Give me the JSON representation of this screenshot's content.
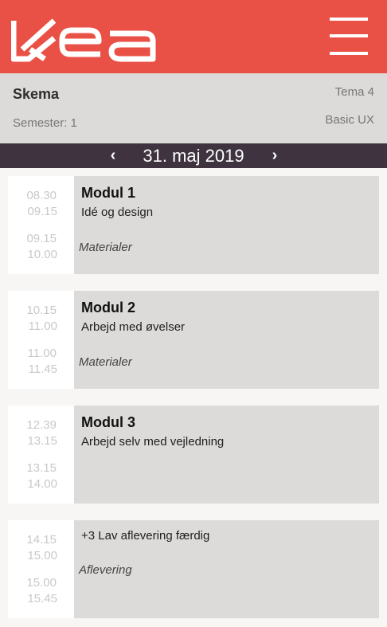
{
  "header": {
    "logo_text": "KEA",
    "menu_icon": "hamburger-menu-icon"
  },
  "info": {
    "title": "Skema",
    "semester": "Semester: 1",
    "tema": "Tema 4",
    "course": "Basic UX"
  },
  "datebar": {
    "prev_icon": "chevron-left-icon",
    "prev_glyph": "‹",
    "date": "31. maj 2019",
    "next_icon": "chevron-right-icon",
    "next_glyph": "›"
  },
  "schedule": [
    {
      "times": [
        "08.30",
        "09.15",
        "09.15",
        "10.00"
      ],
      "title": "Modul 1",
      "description": "Idé og design",
      "link": "Materialer"
    },
    {
      "times": [
        "10.15",
        "11.00",
        "11.00",
        "11.45"
      ],
      "title": "Modul 2",
      "description": "Arbejd med øvelser",
      "link": "Materialer"
    },
    {
      "times": [
        "12.39",
        "13.15",
        "13.15",
        "14.00"
      ],
      "title": "Modul 3",
      "description": "Arbejd selv med vejledning",
      "link": ""
    },
    {
      "times": [
        "14.15",
        "15.00",
        "15.00",
        "15.45"
      ],
      "title": "",
      "description": "+3 Lav aflevering færdig",
      "link": "Aflevering"
    }
  ],
  "colors": {
    "brand_red": "#ea5146",
    "date_bar": "#3f3340",
    "panel_grey": "#dcdbd9"
  }
}
